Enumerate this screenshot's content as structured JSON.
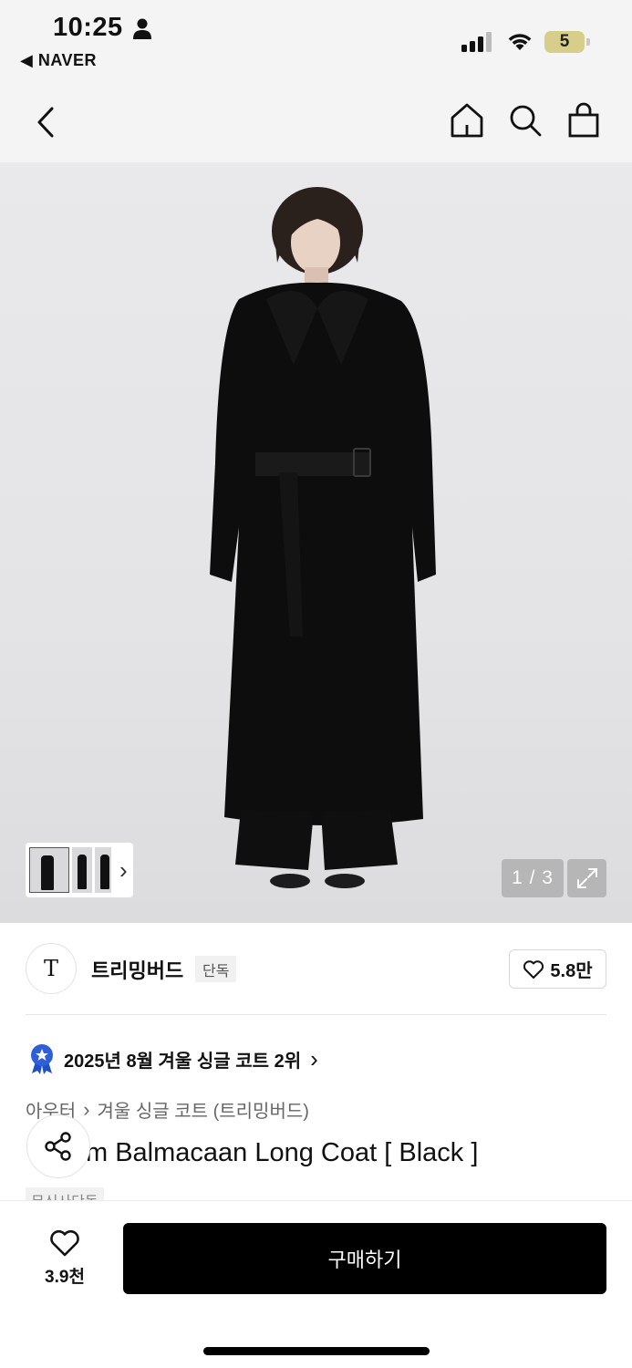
{
  "status_bar": {
    "time": "10:25",
    "back_app": "◀ NAVER",
    "battery": "5",
    "icons": [
      "person-icon",
      "cellular-signal-icon",
      "wifi-icon",
      "battery-icon"
    ]
  },
  "nav": {
    "icons": [
      "back-chevron-icon",
      "home-icon",
      "search-icon",
      "shopping-bag-icon"
    ]
  },
  "gallery": {
    "counter": "1 / 3",
    "thumbnail_more": "›",
    "icons": [
      "expand-icon"
    ]
  },
  "brand": {
    "logo": "T",
    "name": "트리밍버드",
    "badge": "단독",
    "likes": "5.8만"
  },
  "ranking": {
    "text": "2025년 8월 겨울 싱글 코트 2위",
    "arrow": "›"
  },
  "breadcrumb": {
    "category": "아우터",
    "subcategory": "겨울 싱글 코트 (트리밍버드)"
  },
  "product": {
    "title": "m Balmacaan Long Coat [ Black ]",
    "tag": "무신사단독"
  },
  "bottom_bar": {
    "wish_count": "3.9천",
    "buy_label": "구매하기"
  },
  "colors": {
    "accent_badge": "#2f5fd6",
    "buy_button": "#000000",
    "battery": "#d8ce8b"
  }
}
